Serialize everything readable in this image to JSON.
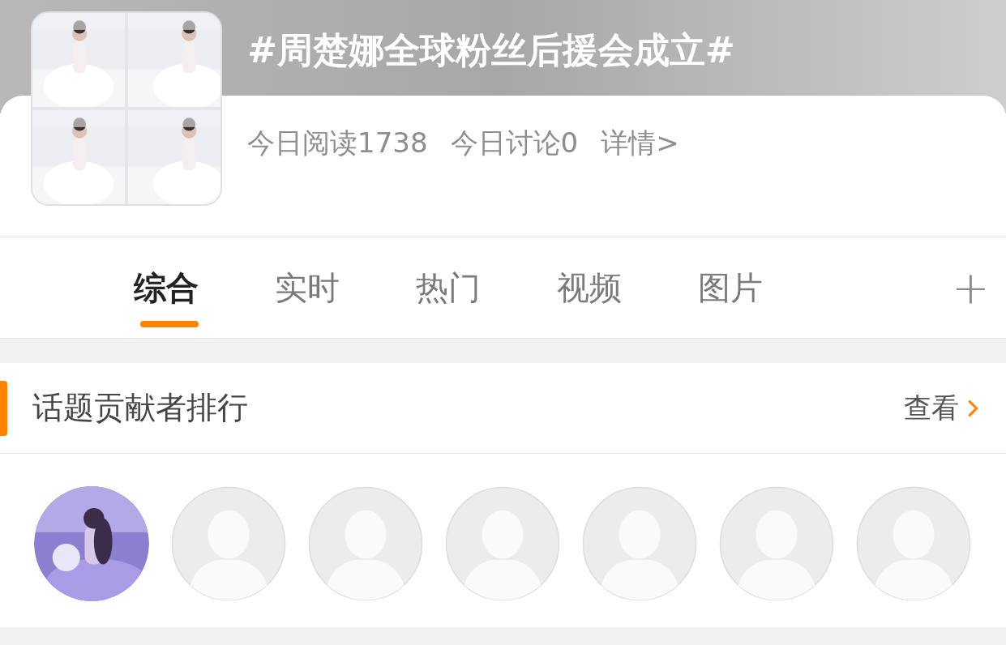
{
  "topic": {
    "title": "#周楚娜全球粉丝后援会成立#",
    "cover": [
      {
        "kind": "picture"
      },
      {
        "kind": "picture"
      },
      {
        "kind": "picture"
      },
      {
        "kind": "picture"
      }
    ],
    "stats": [
      "今日阅读1738",
      "今日讨论0",
      "详情>"
    ]
  },
  "tabs": [
    {
      "label": "综合",
      "selected": true
    },
    {
      "label": "实时",
      "selected": false
    },
    {
      "label": "热门",
      "selected": false
    },
    {
      "label": "视频",
      "selected": false
    },
    {
      "label": "图片",
      "selected": false
    }
  ],
  "tabs_more": "+",
  "contributors": {
    "title": "话题贡献者排行",
    "link": "查看",
    "avatars": [
      {
        "kind": "picture"
      },
      {
        "kind": "placeholder"
      },
      {
        "kind": "placeholder"
      },
      {
        "kind": "placeholder"
      },
      {
        "kind": "placeholder"
      },
      {
        "kind": "placeholder"
      },
      {
        "kind": "placeholder"
      }
    ]
  }
}
